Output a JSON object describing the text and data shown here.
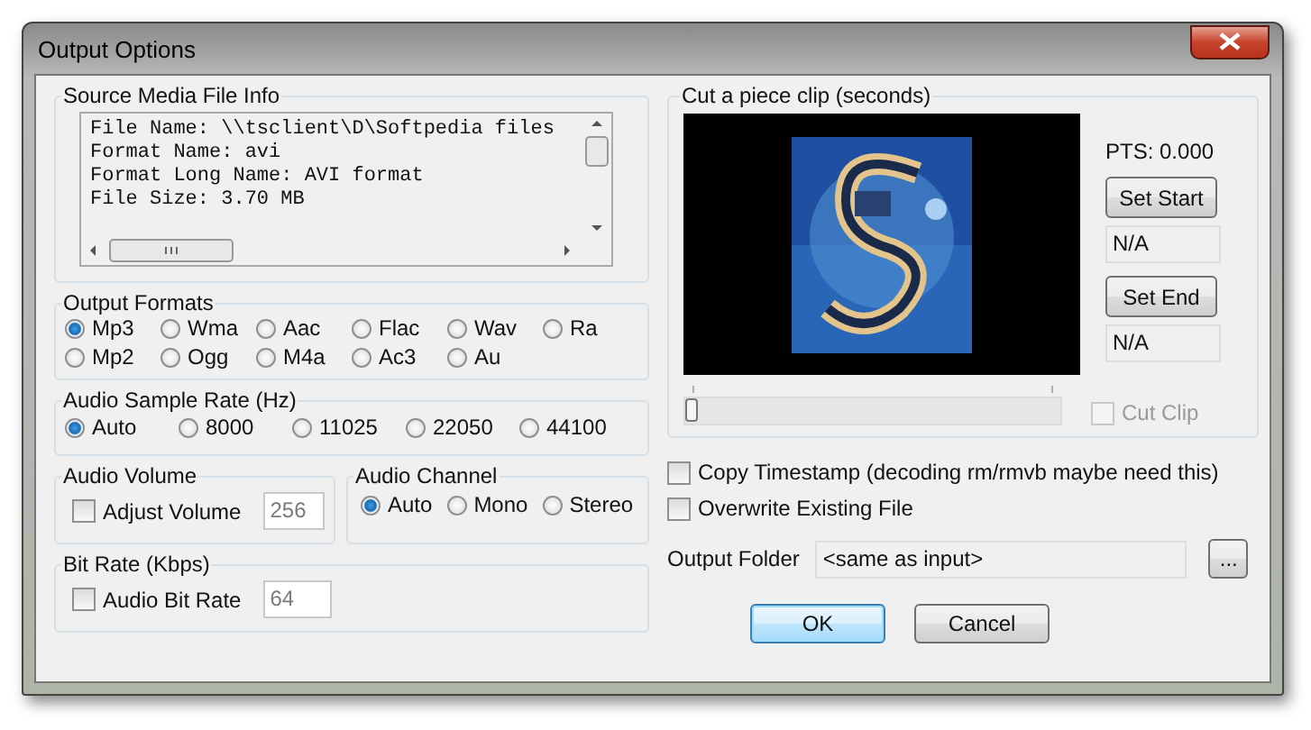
{
  "window": {
    "title": "Output Options"
  },
  "source_info": {
    "title": "Source Media File Info",
    "lines": [
      "File Name: \\\\tsclient\\D\\Softpedia files",
      "Format Name: avi",
      "Format Long Name: AVI format",
      "File Size: 3.70 MB"
    ]
  },
  "output_formats": {
    "title": "Output Formats",
    "options": [
      {
        "label": "Mp3",
        "selected": true
      },
      {
        "label": "Wma",
        "selected": false
      },
      {
        "label": "Aac",
        "selected": false
      },
      {
        "label": "Flac",
        "selected": false
      },
      {
        "label": "Wav",
        "selected": false
      },
      {
        "label": "Ra",
        "selected": false
      },
      {
        "label": "Mp2",
        "selected": false
      },
      {
        "label": "Ogg",
        "selected": false
      },
      {
        "label": "M4a",
        "selected": false
      },
      {
        "label": "Ac3",
        "selected": false
      },
      {
        "label": "Au",
        "selected": false
      }
    ]
  },
  "sample_rate": {
    "title": "Audio Sample Rate (Hz)",
    "options": [
      {
        "label": "Auto",
        "selected": true
      },
      {
        "label": "8000",
        "selected": false
      },
      {
        "label": "11025",
        "selected": false
      },
      {
        "label": "22050",
        "selected": false
      },
      {
        "label": "44100",
        "selected": false
      }
    ]
  },
  "audio_volume": {
    "title": "Audio Volume",
    "checkbox": {
      "label": "Adjust Volume",
      "checked": false
    },
    "value": "256",
    "disabled": true
  },
  "audio_channel": {
    "title": "Audio Channel",
    "options": [
      {
        "label": "Auto",
        "selected": true
      },
      {
        "label": "Mono",
        "selected": false
      },
      {
        "label": "Stereo",
        "selected": false
      }
    ]
  },
  "bit_rate": {
    "title": "Bit Rate (Kbps)",
    "checkbox": {
      "label": "Audio Bit Rate",
      "checked": false
    },
    "value": "64",
    "disabled": true
  },
  "clip": {
    "title": "Cut a piece clip (seconds)",
    "pts": "PTS: 0.000",
    "set_start": "Set Start",
    "start_value": "N/A",
    "set_end": "Set End",
    "end_value": "N/A",
    "slider": {
      "level": 0
    },
    "cut_clip": {
      "label": "Cut Clip",
      "checked": false,
      "disabled": true
    }
  },
  "options": [
    {
      "label": "Copy Timestamp (decoding rm/rmvb maybe need this)",
      "checked": false
    },
    {
      "label": "Overwrite Existing File",
      "checked": false
    }
  ],
  "output_folder": {
    "label": "Output Folder",
    "value": "<same as input>",
    "browse": "..."
  },
  "buttons": [
    {
      "label": "OK",
      "default": true
    },
    {
      "label": "Cancel",
      "default": false
    }
  ]
}
